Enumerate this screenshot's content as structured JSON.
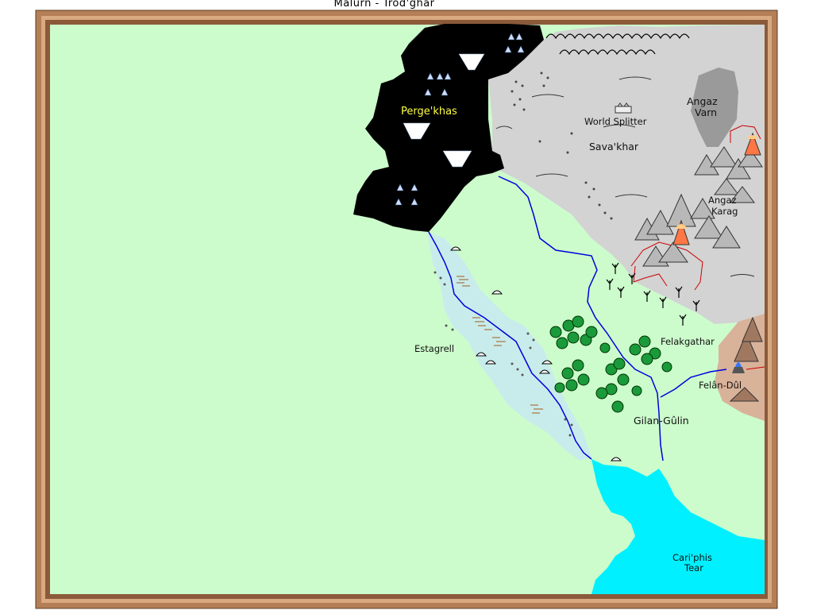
{
  "map": {
    "title": "Malurn - Trod'ghar",
    "colors": {
      "frame": "#b47e57",
      "grassland": "#ccfccc",
      "mountains_region": "#d3d3d3",
      "dark_mountains": "#000000",
      "marsh": "#c8ecec",
      "sea": "#00f0ff",
      "river": "#0000dd",
      "border": "#cc0000"
    },
    "labels": {
      "perge_khas": "Perge'khas",
      "world_splitter": "World Splitter",
      "sava_khar": "Sava'khar",
      "angaz_varn_1": "Angaz",
      "angaz_varn_2": "Varn",
      "angaz_karag_1": "Angaz",
      "angaz_karag_2": "Karag",
      "felakgathar": "Felakgathar",
      "felan_dul": "Felân-Dûl",
      "estagrell": "Estagrell",
      "gilan_gulin": "Gilan-Gûlin",
      "cariphis_1": "Cari'phis",
      "cariphis_2": "Tear"
    }
  }
}
